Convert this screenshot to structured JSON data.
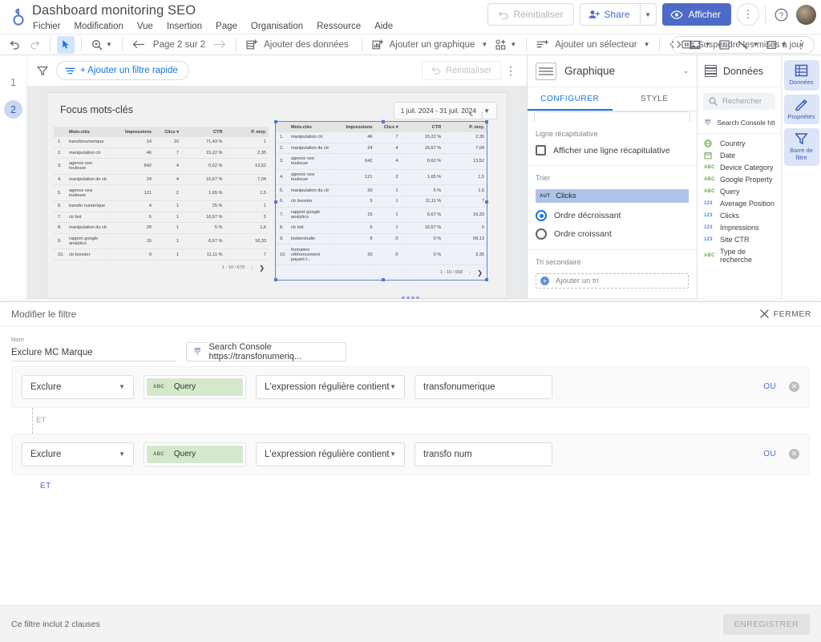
{
  "header": {
    "doc_title": "Dashboard monitoring SEO",
    "logo_icon": "looker-studio-logo-icon",
    "menus": [
      "Fichier",
      "Modification",
      "Vue",
      "Insertion",
      "Page",
      "Organisation",
      "Ressource",
      "Aide"
    ],
    "reset_label": "Réinitialiser",
    "share_label": "Share",
    "view_label": "Afficher",
    "more_icon": "kebab-menu-icon",
    "help_icon": "help-circle-icon",
    "avatar_icon": "user-avatar"
  },
  "toolbar": {
    "undo_icon": "undo-icon",
    "redo_icon": "redo-icon",
    "select_icon": "cursor-select-icon",
    "zoom_icon": "magnifier-icon",
    "prev_icon": "arrow-left-icon",
    "page_indicator": "Page 2 sur 2",
    "next_icon": "arrow-right-icon",
    "add_data_label": "Ajouter des données",
    "add_chart_label": "Ajouter un graphique",
    "add_control_icon": "add-control-icon",
    "add_selector_label": "Ajouter un sélecteur",
    "embed_icon": "embed-code-icon",
    "image_icon": "image-icon",
    "text_icon": "text-box-icon",
    "line_icon": "line-icon",
    "shape_icon": "rectangle-icon",
    "more_icon": "kebab-menu-icon",
    "pause_label": "Suspendre les mises à jour",
    "pause_icon": "pause-icon"
  },
  "pages": {
    "items": [
      "1",
      "2"
    ],
    "active": "2"
  },
  "filter_bar": {
    "funnel_icon": "funnel-icon",
    "quick_filter_label": "+ Ajouter un filtre rapide",
    "quick_filter_icon": "filter-lines-icon",
    "reset_label": "Réinitialiser",
    "reset_icon": "undo-icon",
    "more_icon": "kebab-menu-icon"
  },
  "canvas": {
    "report_title": "Focus mots-clés",
    "date_range": "1 juil. 2024 - 31 juil. 2024",
    "date_caret_icon": "chevron-down-icon",
    "edit_icon": "pencil-icon",
    "chart_more_icon": "kebab-menu-icon"
  },
  "chart_data": [
    {
      "type": "table",
      "title": "Focus mots-clés (tableau 1)",
      "columns": [
        "",
        "Mots-clés",
        "Impressions",
        "Clics",
        "CTR",
        "P. moy."
      ],
      "sort_column": "Clics",
      "rows": [
        [
          "1.",
          "transfonumerique",
          "14",
          "10",
          "71,43 %",
          "1"
        ],
        [
          "2.",
          "manipulation ctr",
          "46",
          "7",
          "15,22 %",
          "2,35"
        ],
        [
          "3.",
          "agence seo toulouse",
          "642",
          "4",
          "0,62 %",
          "13,52"
        ],
        [
          "4.",
          "manipulation de ctr",
          "24",
          "4",
          "16,67 %",
          "7,04"
        ],
        [
          "5.",
          "agence sea toulouse",
          "121",
          "2",
          "1,65 %",
          "1,5"
        ],
        [
          "6.",
          "transfo numérique",
          "4",
          "1",
          "25 %",
          "1"
        ],
        [
          "7.",
          "ctr bot",
          "6",
          "1",
          "16,67 %",
          "5"
        ],
        [
          "8.",
          "manipulation du ctr",
          "20",
          "1",
          "5 %",
          "1,6"
        ],
        [
          "9.",
          "rapport google analytics",
          "15",
          "1",
          "6,67 %",
          "16,33"
        ],
        [
          "10.",
          "ctr booster",
          "9",
          "1",
          "11,11 %",
          "7"
        ]
      ],
      "pagination": "1 - 10 / 670"
    },
    {
      "type": "table",
      "title": "Focus mots-clés (tableau 2 - sélectionné)",
      "columns": [
        "",
        "Mots-clés",
        "Impressions",
        "Clics",
        "CTR",
        "P. moy."
      ],
      "sort_column": "Clics",
      "rows": [
        [
          "1.",
          "manipulation ctr",
          "46",
          "7",
          "15,22 %",
          "2,35"
        ],
        [
          "2.",
          "manipulation de ctr",
          "24",
          "4",
          "16,67 %",
          "7,04"
        ],
        [
          "3.",
          "agence seo toulouse",
          "642",
          "4",
          "0,62 %",
          "13,52"
        ],
        [
          "4.",
          "agence sea toulouse",
          "121",
          "2",
          "1,65 %",
          "1,5"
        ],
        [
          "5.",
          "manipulation du ctr",
          "20",
          "1",
          "5 %",
          "1,6"
        ],
        [
          "6.",
          "ctr booster",
          "9",
          "1",
          "11,11 %",
          "7"
        ],
        [
          "7.",
          "rapport google analytics",
          "15",
          "1",
          "6,67 %",
          "16,33"
        ],
        [
          "8.",
          "ctr bot",
          "6",
          "1",
          "16,67 %",
          "5"
        ],
        [
          "9.",
          "lookerstudio",
          "8",
          "0",
          "0 %",
          "68,13"
        ],
        [
          "10.",
          "formation référencement payant t...",
          "20",
          "0",
          "0 %",
          "3,35"
        ]
      ],
      "pagination": "1 - 10 / 668"
    }
  ],
  "properties_panel": {
    "thumb_icon": "table-chart-icon",
    "title": "Graphique",
    "collapse_icon": "chevron-down-icon",
    "tabs": [
      {
        "label": "CONFIGURER",
        "active": true
      },
      {
        "label": "STYLE",
        "active": false
      }
    ],
    "summary_section_label": "Ligne récapitulative",
    "summary_checkbox_label": "Afficher une ligne récapitulative",
    "sort_section_label": "Trier",
    "sort_field": "Clicks",
    "sort_field_type": "AUT",
    "sort_desc_label": "Ordre décroissant",
    "sort_asc_label": "Ordre croissant",
    "secondary_sort_label": "Tri secondaire",
    "add_sort_label": "Ajouter un tri"
  },
  "data_panel": {
    "title": "Données",
    "header_icon": "database-icon",
    "search_placeholder": "Rechercher",
    "search_icon": "search-icon",
    "source_label": "Search Console https:...",
    "source_icon": "search-console-icon",
    "fields": [
      {
        "name": "Country",
        "type": "geo",
        "icon": "globe-icon"
      },
      {
        "name": "Date",
        "type": "date",
        "icon": "calendar-icon"
      },
      {
        "name": "Device Category",
        "type": "ABC",
        "icon": "text-type-icon"
      },
      {
        "name": "Google Property",
        "type": "ABC",
        "icon": "text-type-icon"
      },
      {
        "name": "Query",
        "type": "ABC",
        "icon": "text-type-icon"
      },
      {
        "name": "Average Position",
        "type": "123",
        "icon": "number-type-icon"
      },
      {
        "name": "Clicks",
        "type": "123",
        "icon": "number-type-icon"
      },
      {
        "name": "Impressions",
        "type": "123",
        "icon": "number-type-icon"
      },
      {
        "name": "Site CTR",
        "type": "123",
        "icon": "number-type-icon"
      },
      {
        "name": "Type de recherche",
        "type": "ABC",
        "icon": "text-type-icon"
      }
    ]
  },
  "rail": [
    {
      "label": "Données",
      "icon": "database-icon"
    },
    {
      "label": "Propriétés",
      "icon": "pencil-icon"
    },
    {
      "label": "Barre de filtre",
      "icon": "funnel-icon"
    }
  ],
  "dialog": {
    "title": "Modifier le filtre",
    "close_label": "FERMER",
    "close_icon": "close-x-icon",
    "name_label": "Nom",
    "name_value": "Exclure MC Marque",
    "source_value": "Search Console https://transfonumeriq...",
    "source_icon": "search-console-icon",
    "clauses": [
      {
        "include_mode": "Exclure",
        "field": "Query",
        "field_type": "ABC",
        "operator": "L'expression régulière contient",
        "value": "transfonumerique",
        "or_label": "OU",
        "remove_icon": "remove-circle-icon",
        "caret_icon": "chevron-down-icon"
      },
      {
        "include_mode": "Exclure",
        "field": "Query",
        "field_type": "ABC",
        "operator": "L'expression régulière contient",
        "value": "transfo num",
        "or_label": "OU",
        "remove_icon": "remove-circle-icon",
        "caret_icon": "chevron-down-icon"
      }
    ],
    "and_connector_label": "ET",
    "add_and_label": "ET",
    "footer_text": "Ce filtre inclut 2 clauses",
    "save_label": "ENREGISTRER"
  },
  "colors": {
    "accent_blue": "#4d6bc6",
    "link_blue": "#1a73e8",
    "field_chip_green": "#d4e8cd",
    "sort_chip_blue": "#aec3e8",
    "selection_blue": "#5b86d8"
  }
}
